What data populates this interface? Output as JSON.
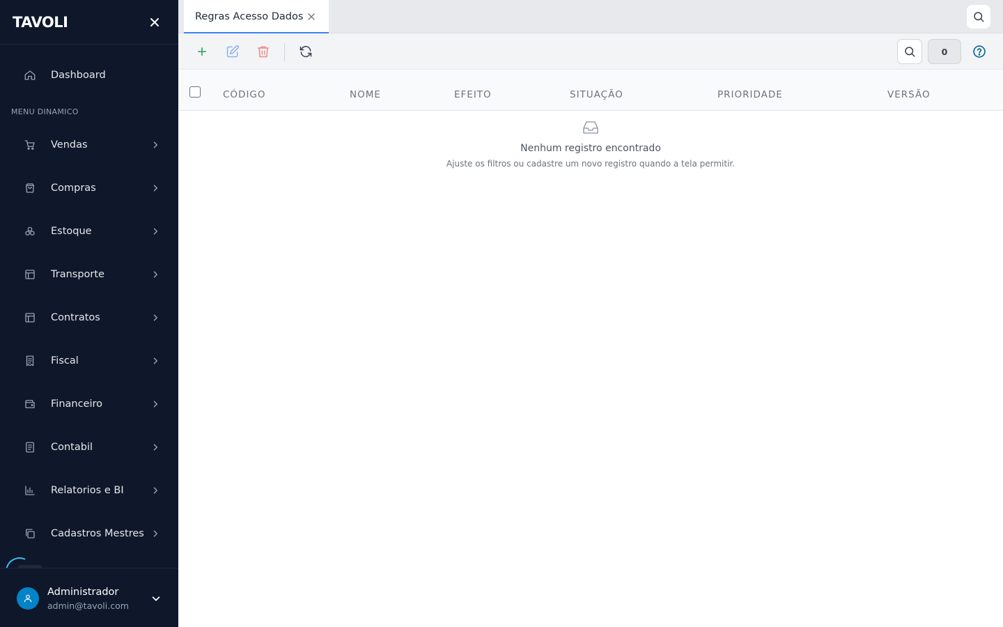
{
  "sidebar": {
    "brand": "TAVOLI",
    "dashboard_label": "Dashboard",
    "section_label": "MENU DINAMICO",
    "items": [
      {
        "label": "Vendas",
        "icon": "cart-icon"
      },
      {
        "label": "Compras",
        "icon": "shopping-bag-icon"
      },
      {
        "label": "Estoque",
        "icon": "boxes-icon"
      },
      {
        "label": "Transporte",
        "icon": "layout-icon"
      },
      {
        "label": "Contratos",
        "icon": "layout-icon"
      },
      {
        "label": "Fiscal",
        "icon": "receipt-icon"
      },
      {
        "label": "Financeiro",
        "icon": "wallet-icon"
      },
      {
        "label": "Contabil",
        "icon": "book-icon"
      },
      {
        "label": "Relatorios e BI",
        "icon": "bar-chart-icon"
      },
      {
        "label": "Cadastros Mestres",
        "icon": "copy-icon"
      }
    ],
    "user": {
      "name": "Administrador",
      "email": "admin@tavoli.com"
    }
  },
  "tabs": [
    {
      "label": "Regras Acesso Dados",
      "active": true
    }
  ],
  "toolbar": {
    "count": "0"
  },
  "table": {
    "columns": [
      "CÓDIGO",
      "NOME",
      "EFEITO",
      "SITUAÇÃO",
      "PRIORIDADE",
      "VERSÃO"
    ],
    "rows": []
  },
  "empty_state": {
    "title": "Nenhum registro encontrado",
    "subtitle": "Ajuste os filtros ou cadastre um novo registro quando a tela permitir."
  },
  "colors": {
    "sidebar_bg": "#0f172a",
    "accent": "#3b82f6",
    "add": "#16a34a",
    "delete": "#ef4444",
    "avatar": "#0284c7"
  }
}
